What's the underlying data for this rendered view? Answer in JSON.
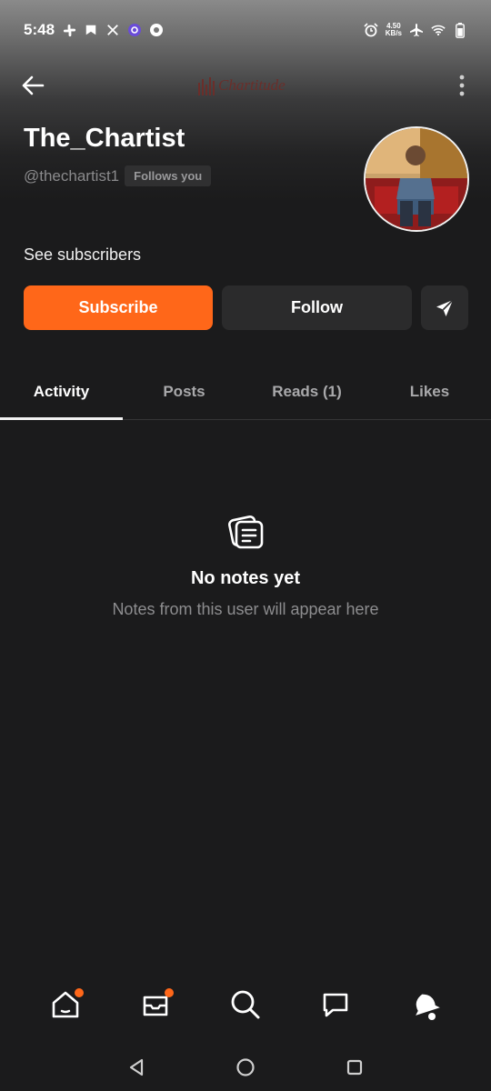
{
  "status_bar": {
    "time": "5:48",
    "net_speed_value": "4.50",
    "net_speed_unit": "KB/s",
    "left_icons": [
      "slack-icon",
      "bookmark-icon",
      "x-icon",
      "settings-badge-icon",
      "record-icon"
    ],
    "right_icons": [
      "alarm-icon",
      "airplane-icon",
      "wifi-icon",
      "battery-icon"
    ]
  },
  "app_bar": {
    "logo_text": "Chartitude"
  },
  "profile": {
    "name": "The_Chartist",
    "handle": "@thechartist1",
    "follows_badge": "Follows you",
    "see_subscribers": "See subscribers"
  },
  "actions": {
    "subscribe_label": "Subscribe",
    "follow_label": "Follow"
  },
  "tabs": [
    {
      "label": "Activity",
      "active": true
    },
    {
      "label": "Posts",
      "active": false
    },
    {
      "label": "Reads (1)",
      "active": false
    },
    {
      "label": "Likes",
      "active": false
    }
  ],
  "empty_state": {
    "title": "No notes yet",
    "subtitle": "Notes from this user will appear here"
  },
  "bottom_nav": [
    {
      "icon": "home-icon",
      "has_dot": true
    },
    {
      "icon": "inbox-icon",
      "has_dot": true
    },
    {
      "icon": "search-icon",
      "has_dot": false
    },
    {
      "icon": "chat-icon",
      "has_dot": false
    },
    {
      "icon": "bell-icon",
      "has_dot": false
    }
  ],
  "colors": {
    "accent": "#ff6719",
    "background": "#1b1b1c",
    "button_dark": "#2b2b2c"
  }
}
